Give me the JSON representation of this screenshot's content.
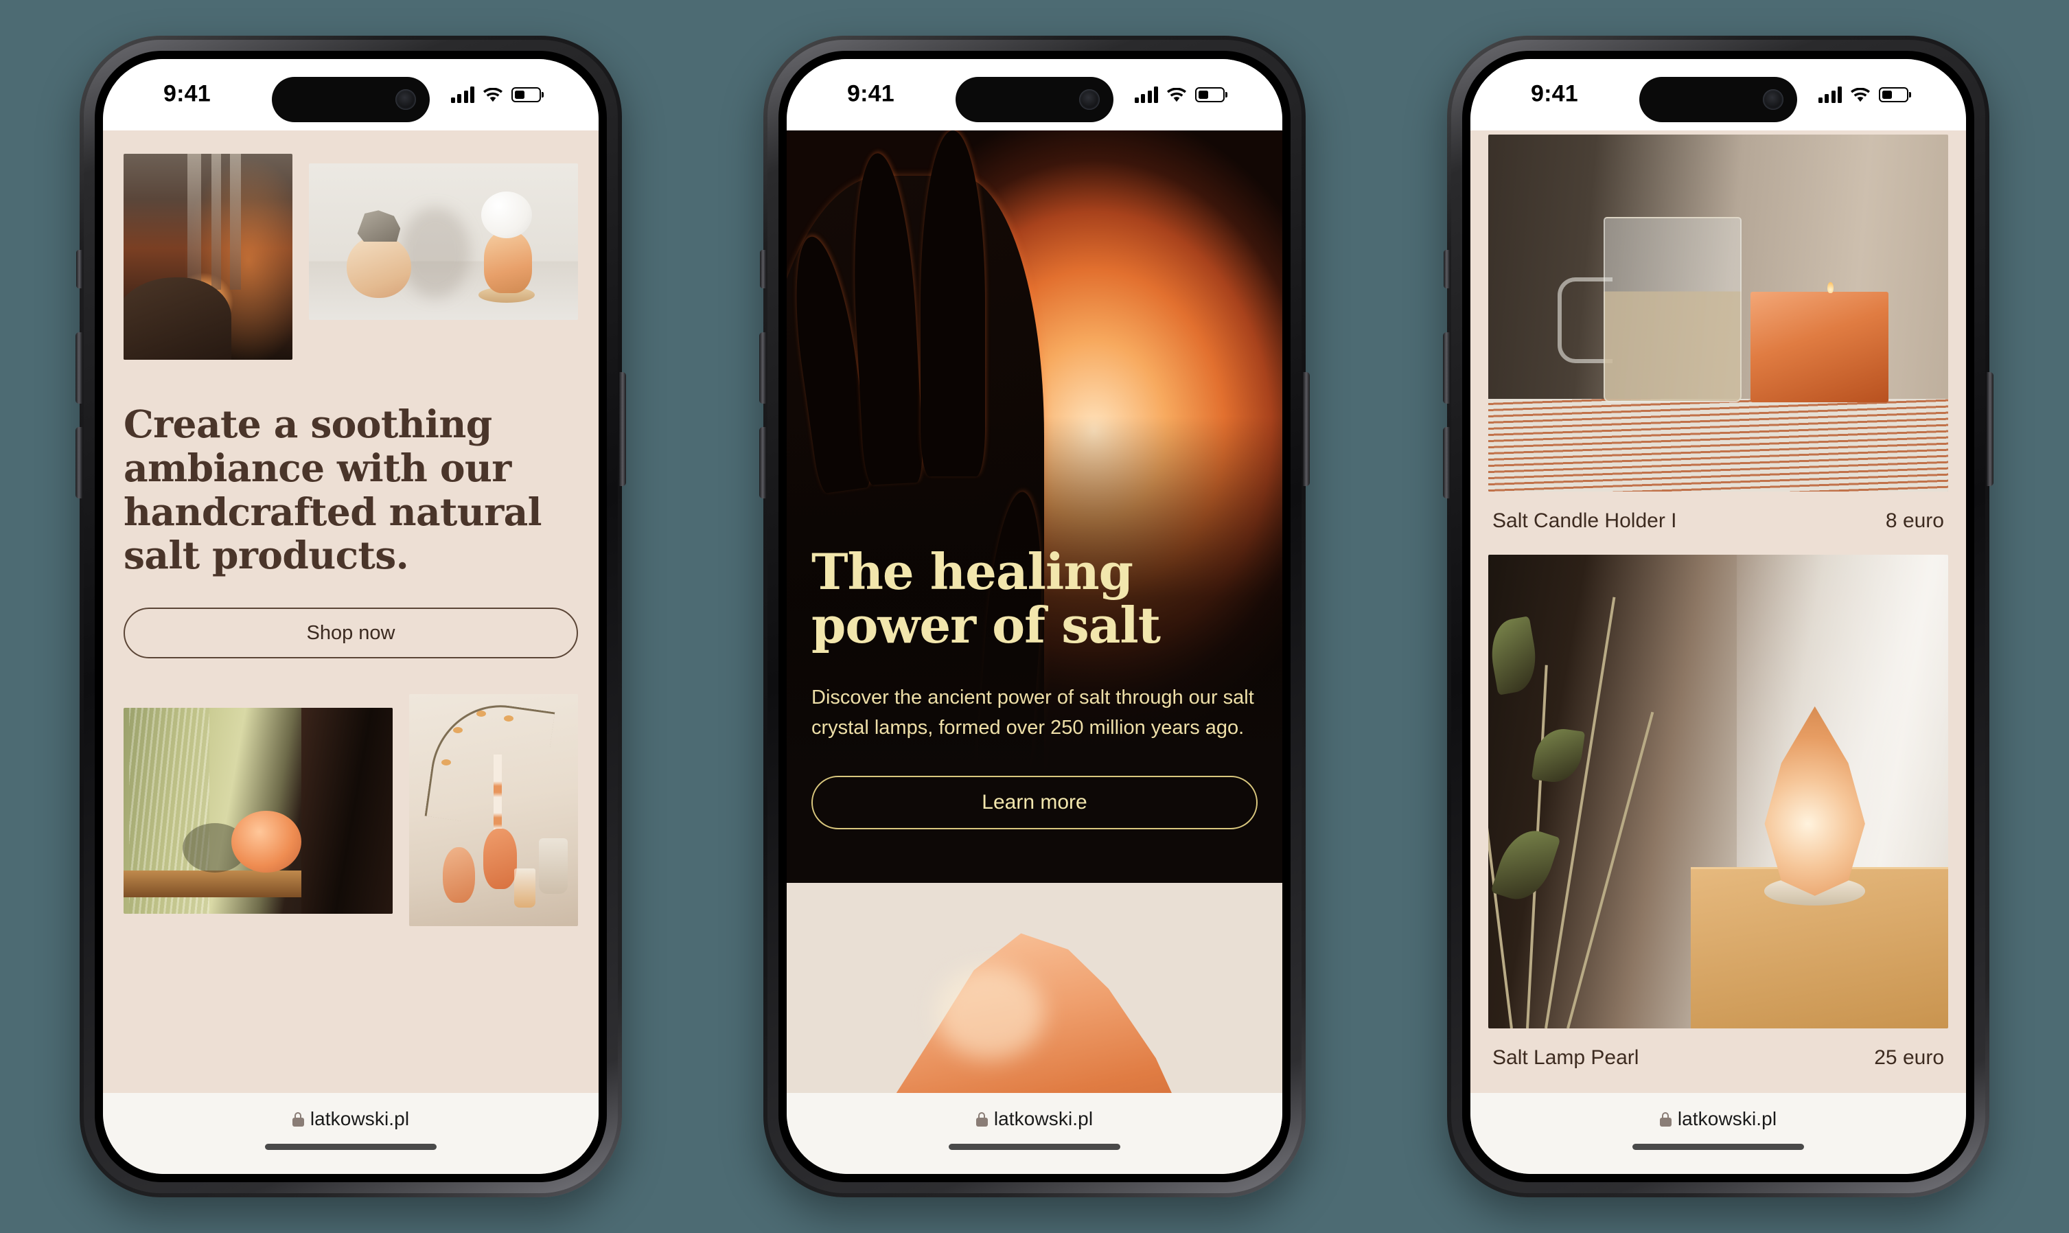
{
  "background_color": "#4d6b73",
  "brand": {
    "cream": "#eddfd4",
    "ink": "#3d2b20",
    "gold": "#f2e6ad",
    "dark": "#0d0806"
  },
  "status_bar": {
    "time": "9:41",
    "signal_icon": "cellular-signal-icon",
    "wifi_icon": "wifi-icon",
    "battery_icon": "battery-icon",
    "battery_level": "40%"
  },
  "browser_bar": {
    "lock_icon": "lock-icon",
    "url": "latkowski.pl",
    "home_indicator": "home-indicator"
  },
  "phones": [
    {
      "name": "phone-landing",
      "screen": "gallery-landing",
      "images_top": [
        {
          "name": "dark-room-salt-lamp-photo",
          "alt": "Dark room with glowing salt lamp on a side table"
        },
        {
          "name": "salt-objects-shelf-photo",
          "alt": "Salt stone object and salt lamp with white globe on a shelf"
        }
      ],
      "headline": "Create a soothing ambiance with our handcrafted natural salt products.",
      "cta_label": "Shop now",
      "images_bottom": [
        {
          "name": "window-salt-lamp-photo",
          "alt": "Salt lamp by a green curtained window"
        },
        {
          "name": "candle-branches-photo",
          "alt": "Salt candle holders with dried branches on a table"
        }
      ]
    },
    {
      "name": "phone-article",
      "screen": "hero-article",
      "hero_image": {
        "name": "hand-over-salt-lamp-photo",
        "alt": "Silhouette of a hand over a glowing salt lamp"
      },
      "title": "The healing power of salt",
      "subtitle": "Discover the ancient power of salt through our salt crystal lamps, formed over 250 million years ago.",
      "cta_label": "Learn more",
      "bottom_image": {
        "name": "salt-crystal-rock-photo",
        "alt": "Large pink salt crystal rock on cream background"
      }
    },
    {
      "name": "phone-shop",
      "screen": "product-list",
      "products": [
        {
          "name": "Salt Candle Holder I",
          "price": "8 euro",
          "image": {
            "name": "mug-and-salt-candle-photo",
            "alt": "Glass mug of water beside a lit salt candle block"
          }
        },
        {
          "name": "Salt Lamp Pearl",
          "price": "25 euro",
          "image": {
            "name": "teardrop-salt-lamp-photo",
            "alt": "Teardrop salt lamp glowing on a wooden cabinet beside plants"
          }
        }
      ]
    }
  ]
}
